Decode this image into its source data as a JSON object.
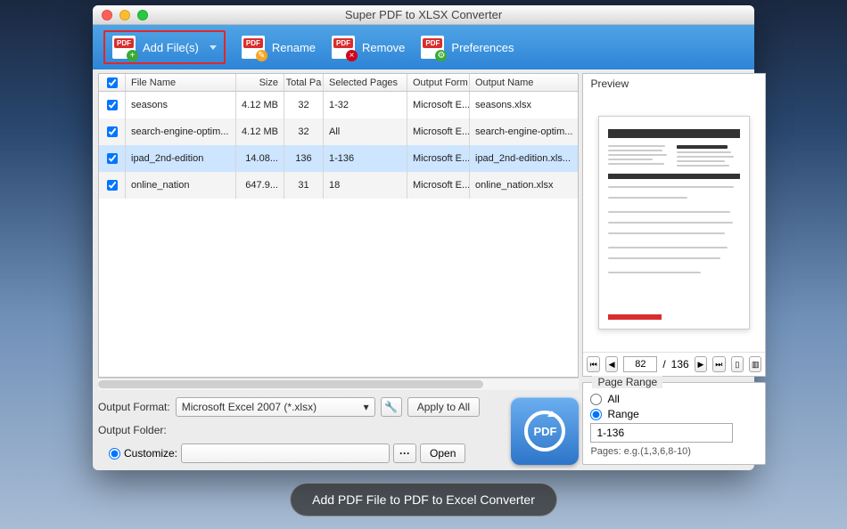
{
  "window": {
    "title": "Super PDF to XLSX Converter"
  },
  "toolbar": {
    "add": "Add File(s)",
    "rename": "Rename",
    "remove": "Remove",
    "prefs": "Preferences"
  },
  "columns": {
    "chk": "",
    "name": "File Name",
    "size": "Size",
    "total": "Total Pa",
    "selected": "Selected Pages",
    "format": "Output Form",
    "output": "Output Name"
  },
  "rows": [
    {
      "checked": true,
      "name": "seasons",
      "size": "4.12 MB",
      "total": "32",
      "selected": "1-32",
      "format": "Microsoft E...",
      "output": "seasons.xlsx"
    },
    {
      "checked": true,
      "name": "search-engine-optim...",
      "size": "4.12 MB",
      "total": "32",
      "selected": "All",
      "format": "Microsoft E...",
      "output": "search-engine-optim..."
    },
    {
      "checked": true,
      "name": "ipad_2nd-edition",
      "size": "14.08...",
      "total": "136",
      "selected": "1-136",
      "format": "Microsoft E...",
      "output": "ipad_2nd-edition.xls...",
      "sel": true
    },
    {
      "checked": true,
      "name": "online_nation",
      "size": "647.9...",
      "total": "31",
      "selected": "18",
      "format": "Microsoft E...",
      "output": "online_nation.xlsx"
    }
  ],
  "output": {
    "format_label": "Output Format:",
    "format_value": "Microsoft Excel 2007 (*.xlsx)",
    "apply": "Apply to All",
    "folder_label": "Output Folder:",
    "customize": "Customize:",
    "open": "Open",
    "convert": "PDF"
  },
  "preview": {
    "title": "Preview",
    "page_current": "82",
    "page_total": "136",
    "sep": "/"
  },
  "range": {
    "legend": "Page Range",
    "all": "All",
    "range": "Range",
    "value": "1-136",
    "hint": "Pages: e.g.(1,3,6,8-10)"
  },
  "caption": "Add PDF File to PDF to Excel Converter"
}
